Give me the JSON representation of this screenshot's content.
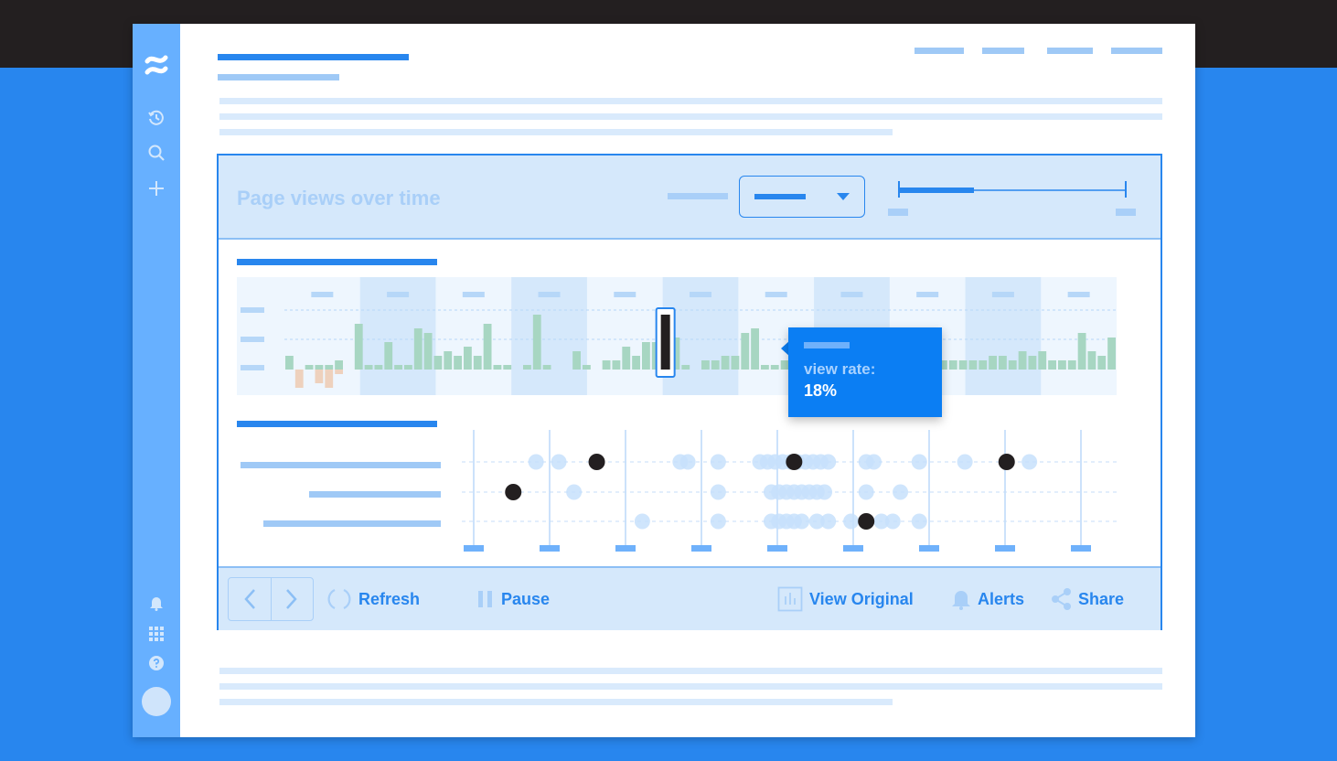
{
  "chart": {
    "title": "Page views over time"
  },
  "tooltip": {
    "label": "view rate:",
    "value": "18%"
  },
  "toolbar": {
    "refresh_label": "Refresh",
    "pause_label": "Pause",
    "view_original_label": "View Original",
    "alerts_label": "Alerts",
    "share_label": "Share"
  },
  "sidebar": {
    "icons": [
      "app-logo-icon",
      "history-icon",
      "search-icon",
      "plus-icon",
      "notification-bell-icon",
      "app-grid-icon",
      "help-icon"
    ]
  },
  "colors": {
    "accent": "#2886ee",
    "positive_bar": "#a7d6c2",
    "negative_bar": "#eed1bd",
    "tooltip_bg": "#0b7ef3",
    "highlight_dot": "#231f20"
  },
  "chart_data": {
    "type": "bar",
    "title": "",
    "xlabel": "",
    "ylabel": "",
    "values": [
      1.5,
      0,
      0.5,
      0.5,
      0.5,
      1,
      0,
      5,
      0.5,
      0.5,
      3,
      0.5,
      0.5,
      4.5,
      4,
      1.5,
      2,
      1.5,
      2.5,
      1.5,
      5,
      0.5,
      0.5,
      0,
      0.5,
      6,
      0.5,
      0,
      0,
      2,
      0.5,
      0,
      1,
      1,
      2.5,
      1.5,
      3,
      3,
      1,
      3.5,
      0.5,
      0,
      1,
      1,
      1.5,
      1.5,
      4,
      4.5,
      0.5,
      0.5,
      1,
      2,
      0.5,
      2,
      1.5,
      1,
      1,
      1.5,
      2,
      2.5,
      2,
      2,
      1.5,
      1,
      1,
      1.5,
      1,
      1,
      1,
      1,
      1,
      1.5,
      1.5,
      1,
      2,
      1.5,
      2,
      1,
      1,
      1,
      4,
      2,
      1.5,
      3.5
    ],
    "negatives": [
      0,
      2,
      0,
      1.5,
      2,
      0.5,
      0,
      0,
      0,
      0,
      0,
      0,
      0,
      0,
      0,
      0,
      0,
      0,
      0,
      0,
      0,
      0,
      0,
      0,
      0,
      0,
      0,
      0,
      0,
      0,
      0,
      0,
      0,
      0,
      0,
      0,
      0,
      0,
      0,
      0,
      0,
      0,
      0,
      0,
      0,
      0,
      0,
      0,
      0,
      0,
      0,
      0,
      0,
      0,
      0,
      0,
      0,
      0,
      0,
      0,
      0,
      0,
      0,
      0,
      0,
      0,
      0,
      0,
      0,
      0,
      0,
      0,
      0,
      0,
      0,
      0,
      0,
      0,
      0,
      0,
      0,
      0,
      0,
      0
    ],
    "highlight_index": 38,
    "highlight_value": 18,
    "shaded_bands": [
      1,
      3,
      5,
      7,
      9,
      11
    ]
  },
  "dot_plot": {
    "type": "scatter",
    "rows": 3,
    "light_points": [
      [
        1.05,
        1.35,
        2.95,
        3.05,
        3.45,
        4.0,
        4.1,
        4.2,
        4.3,
        4.4,
        4.5,
        4.6,
        4.7,
        4.8,
        4.9,
        5.4,
        5.5,
        6.1,
        6.7,
        7.55
      ],
      [
        1.55,
        3.45,
        4.15,
        4.25,
        4.35,
        4.45,
        4.55,
        4.65,
        4.75,
        4.85,
        5.4,
        5.85
      ],
      [
        2.45,
        3.45,
        4.15,
        4.25,
        4.35,
        4.45,
        4.55,
        4.75,
        4.9,
        5.2,
        5.6,
        5.75,
        6.1
      ]
    ],
    "dark_points": [
      [
        1.85,
        4.45,
        7.25
      ],
      [
        0.75
      ],
      [
        5.4
      ]
    ]
  }
}
